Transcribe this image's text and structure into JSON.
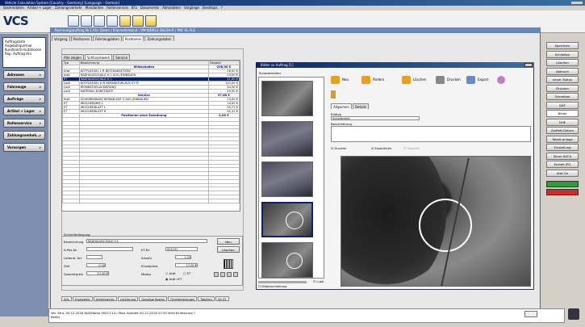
{
  "window_title": "Vehicle Calculation System [Country – Germany] [Language – German]",
  "menu": [
    "Stammdaten",
    "Artikel + Lager",
    "Zahlungsverkehr",
    "Mandanten",
    "Rollenservice",
    "KFz",
    "Dokumente",
    "Abholdaten",
    "Vorgänge",
    "Desktops",
    "?"
  ],
  "app_logo": "VCS",
  "sidebar": {
    "list": [
      "Auftragsliste",
      "Angebotspartner",
      "Kundenkfz-mutationen",
      "Rep. Auftrag Hrs."
    ],
    "nav": [
      "Adressen",
      "Fahrzeuge",
      "Aufträge",
      "Artikel + Lager",
      "Rollenservice",
      "Zahlungsverkeh...",
      "Vorsorgen"
    ]
  },
  "inner_window_title": "Rechnungsauftrag Nr.1  Kfz: Daten / Kilometerstand : VM:WDB11 DKLSH-R / PW: VL-FLS",
  "main_tabs": [
    "Vorgang",
    "Positionen",
    "Fahrzeugdaten",
    "Positionen",
    "Zahlungsdaten"
  ],
  "main_tabs_active": 3,
  "sub_tabs": [
    "Alle zeigen",
    "Schlüsselwerk",
    "Service"
  ],
  "table": {
    "headers": [
      "Typ",
      "Bezeichnung",
      "Gesamt"
    ],
    "rows": [
      {
        "type": "group",
        "label": "Wildschaden",
        "total": "236,00 €"
      },
      {
        "typ": "Arbt",
        "bez": "KOTFLUEGEL L R BESTANDSETZEN",
        "total": "28,00 €"
      },
      {
        "typ": "Arbt",
        "bez": "RADHAUSSCHALE H L AUS-/EINBAUEN",
        "total": "13,00 €"
      },
      {
        "typ": "ET",
        "bez": "RADHAUSSCHALE H L",
        "total": "11,00 €",
        "highlight": true
      },
      {
        "typ": "Lack",
        "bez": "KOTFLUEGEL H R REPARATURLACK ST M",
        "total": "120,00 €"
      },
      {
        "typ": "Lack",
        "bez": "REPARATURLACKIERUNG",
        "total": "34,50 €"
      },
      {
        "typ": "Lack",
        "bez": "MATERIAL KONSTANTE",
        "total": "29,50 €"
      },
      {
        "type": "group",
        "label": "Service",
        "total": "97,60 €"
      },
      {
        "typ": "Arbt",
        "bez": "SCHEIBENWASCHERANLAGE V AUS-/EINBAUEN",
        "total": "13,00 €"
      },
      {
        "typ": "ET",
        "bez": "WISCHERARM L",
        "total": "14,00 €"
      },
      {
        "typ": "ET",
        "bez": "WISCHERBLATT L",
        "total": "35,71 €"
      },
      {
        "typ": "ET",
        "bez": "WISCHERBLATT R",
        "total": "35,31 €"
      },
      {
        "type": "group",
        "label": "Positionen ohne Zuordnung",
        "total": "0,00 €"
      }
    ]
  },
  "detail": {
    "section_label": "Schnellerfassung",
    "fields": {
      "bezeichnung_label": "Bezeichnung",
      "bezeichnung_value": "RADHAUSSCHALE H L",
      "apos_label": "A-Pos-Nr.",
      "etnr_label": "ET-Nr.",
      "etnr_value": "001231",
      "einheit_label": "Leitend. Art",
      "anzahl_label": "Anzahl",
      "anzahl_value": "1,00",
      "zeit_label": "Zeit",
      "zeit_value": "0,00",
      "einzelpreis_label": "Einzelpreis",
      "einzelpreis_value": "11,00 €",
      "gesamtpreis_label": "Gesamtpreis",
      "gesamtpreis_value": "11,00 €",
      "modus_label": "Modus",
      "modus_opts": [
        "Arbt",
        "ET",
        "Arbt+ET"
      ]
    },
    "buttons": [
      "Neu",
      "Löschen"
    ]
  },
  "bottom_tabs": [
    "Alle",
    "Ersatzteile",
    "Arbeitswerte",
    "Lackierung",
    "Sonstige Kosten",
    "Fremdleistungen",
    "Tabellen",
    "Alt 05"
  ],
  "bilder": {
    "title": "Bilder zu Auftrag [1]",
    "thumbs_header": "Schadenbilder",
    "actions": [
      "Neu",
      "Ändern",
      "Löschen",
      "Drucken",
      "Export"
    ],
    "tabs": [
      "Allgemein",
      "Details"
    ],
    "bildtyp_label": "Bildtyp",
    "bildtyp_value": "Schadenbild",
    "beschreibung_label": "Beschreibung",
    "checks": [
      "Drucken",
      "Exportieren",
      "Gesperrt"
    ],
    "zoom_label": "Lupe",
    "bildbeschreibung_label": "Bildbeschreibung"
  },
  "right_buttons": [
    "Speichern",
    "Schließen",
    "Löschen",
    "Abbruch",
    "neuer Status",
    "Drucken",
    "Schreiben",
    "DAT",
    "Bilder",
    "DHE",
    "Audfeft-Datum",
    "Tabelt-anlage",
    "Einstellung",
    "Silver DAT-II",
    "Einheit JPG",
    "Add-On"
  ],
  "status_text_1": "Ver. Stru. 00.12.2018 Dpl/Status 0001+14 | Mod. Kontakt 00.12.2018 07:50 Wird Einfassung ?",
  "status_text_2": "Bedor",
  "colors": {
    "titlebar": "#0a246a",
    "accent_green": "#2e9b3a",
    "accent_red": "#d42a2a",
    "group_text": "#0000aa"
  }
}
